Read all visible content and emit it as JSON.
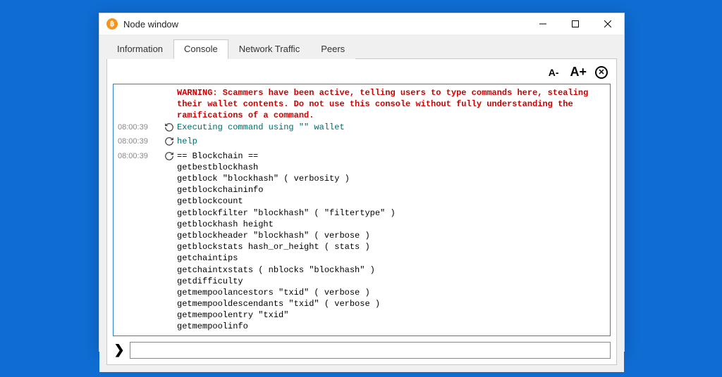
{
  "window": {
    "title": "Node window"
  },
  "tabs": [
    {
      "label": "Information"
    },
    {
      "label": "Console"
    },
    {
      "label": "Network Traffic"
    },
    {
      "label": "Peers"
    }
  ],
  "active_tab": 1,
  "toolbar": {
    "font_smaller": "A-",
    "font_larger": "A+",
    "clear_glyph": "✕"
  },
  "log": [
    {
      "ts": "",
      "icon": "",
      "cls": "red",
      "text": "WARNING: Scammers have been active, telling users to type commands here, stealing their wallet contents. Do not use this console without fully understanding the ramifications of a command."
    },
    {
      "ts": "08:00:39",
      "icon": "undo",
      "cls": "green",
      "text": "Executing command using \"\" wallet"
    },
    {
      "ts": "08:00:39",
      "icon": "redo",
      "cls": "green",
      "text": "help"
    },
    {
      "ts": "08:00:39",
      "icon": "redo",
      "cls": "black",
      "text": "== Blockchain ==\ngetbestblockhash\ngetblock \"blockhash\" ( verbosity )\ngetblockchaininfo\ngetblockcount\ngetblockfilter \"blockhash\" ( \"filtertype\" )\ngetblockhash height\ngetblockheader \"blockhash\" ( verbose )\ngetblockstats hash_or_height ( stats )\ngetchaintips\ngetchaintxstats ( nblocks \"blockhash\" )\ngetdifficulty\ngetmempoolancestors \"txid\" ( verbose )\ngetmempooldescendants \"txid\" ( verbose )\ngetmempoolentry \"txid\"\ngetmempoolinfo"
    }
  ],
  "input": {
    "value": "",
    "placeholder": ""
  },
  "icons": {
    "prompt": "❯"
  }
}
